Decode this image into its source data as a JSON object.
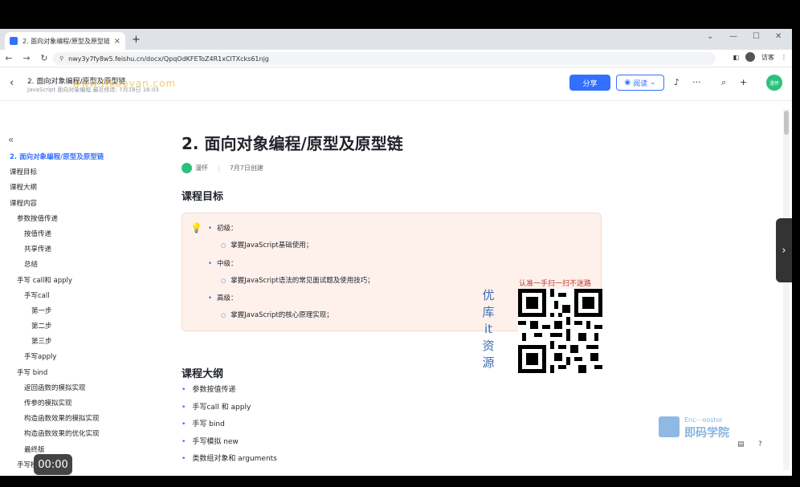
{
  "browser": {
    "tab_title": "2. 面向对象编程/原型及原型链",
    "tab_close": "×",
    "new_tab": "+",
    "url": "nwy3y7fy8w5.feishu.cn/docx/QpqOdKFEToZ4R1xClTXcks61njg",
    "guest_label": "访客",
    "win_controls": [
      "⌄",
      "—",
      "☐",
      "✕"
    ]
  },
  "doc_header": {
    "title": "2. 面向对象编程/原型及原型链",
    "subtitle": "JavaScript 面向对象编程   最近修改: 7月18日 16:03",
    "watermark": "www.itkaoyan.com",
    "share_label": "分享",
    "read_label": "阅读",
    "user_initials": "漫怀"
  },
  "sidebar": {
    "collapse_glyph": "«",
    "items": [
      "2. 面向对象编程/原型及原型链",
      "课程目标",
      "课程大纲",
      "课程内容",
      "参数按值传递",
      "按值传递",
      "共享传递",
      "总结",
      "手写 call和 apply",
      "手写call",
      "第一步",
      "第二步",
      "第三步",
      "手写apply",
      "手写 bind",
      "返回函数的模拟实现",
      "传参的模拟实现",
      "构造函数效果的模拟实现",
      "构造函数效果的优化实现",
      "最终版",
      "手写模拟 new"
    ]
  },
  "main": {
    "title": "2. 面向对象编程/原型及原型链",
    "author": "漫怀",
    "created": "7月7日创建",
    "section_goals": "课程目标",
    "goals": [
      {
        "level": "初级：",
        "detail": "掌握JavaScript基础使用；"
      },
      {
        "level": "中级：",
        "detail": "掌握JavaScript语法的常见面试题及使用技巧；"
      },
      {
        "level": "高级：",
        "detail": "掌握JavaScript的核心原理实现；"
      }
    ],
    "section_outline": "课程大纲",
    "outline": [
      "参数按值传递",
      "手写call 和 apply",
      "手写 bind",
      "手写模拟 new",
      "类数组对象和 arguments"
    ]
  },
  "promo": {
    "vertical_text": "优库it资源",
    "caption": "认准一手扫一扫不迷路",
    "logo_en": "Enc⋯oostor",
    "logo_cn": "即码学院"
  },
  "player": {
    "timecode": "00:00"
  },
  "colors": {
    "accent": "#3370ff",
    "callout_bg": "#fef1ec",
    "avatar": "#2bc07d"
  }
}
